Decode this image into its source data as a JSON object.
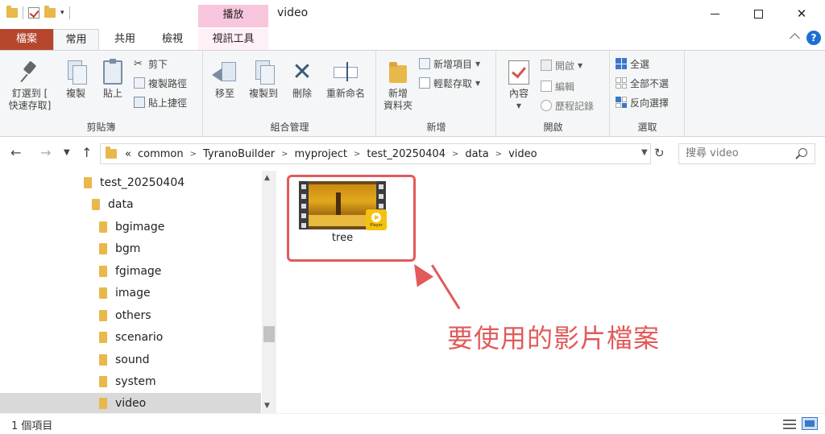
{
  "window": {
    "title": "video",
    "context_tab_header": "播放",
    "buttons": {
      "minimize": "minimize",
      "maximize": "maximize",
      "close": "✕"
    }
  },
  "ribbon_tabs": {
    "file": "檔案",
    "home": "常用",
    "share": "共用",
    "view": "檢視",
    "video_tools": "視訊工具"
  },
  "ribbon": {
    "clipboard": {
      "label": "剪貼簿",
      "pin": "釘選到 [ 快速存取]",
      "pin_line1": "釘選到 [",
      "pin_line2": "快速存取]",
      "copy": "複製",
      "paste": "貼上",
      "cut": "剪下",
      "copy_path": "複製路徑",
      "paste_shortcut": "貼上捷徑"
    },
    "organize": {
      "label": "組合管理",
      "move_to": "移至",
      "copy_to": "複製到",
      "delete": "刪除",
      "rename": "重新命名"
    },
    "new": {
      "label": "新增",
      "new_folder_line1": "新增",
      "new_folder_line2": "資料夾",
      "new_item": "新增項目",
      "easy_access": "輕鬆存取"
    },
    "open": {
      "label": "開啟",
      "properties": "內容",
      "open": "開啟",
      "edit": "編輯",
      "history": "歷程記錄"
    },
    "select": {
      "label": "選取",
      "select_all": "全選",
      "select_none": "全部不選",
      "invert": "反向選擇"
    }
  },
  "address": {
    "prefix": "«",
    "path": [
      "common",
      "TyranoBuilder",
      "myproject",
      "test_20250404",
      "data",
      "video"
    ]
  },
  "search": {
    "placeholder": "搜尋 video"
  },
  "tree": {
    "items": [
      {
        "label": "test_20250404"
      },
      {
        "label": "data"
      },
      {
        "label": "bgimage"
      },
      {
        "label": "bgm"
      },
      {
        "label": "fgimage"
      },
      {
        "label": "image"
      },
      {
        "label": "others"
      },
      {
        "label": "scenario"
      },
      {
        "label": "sound"
      },
      {
        "label": "system"
      },
      {
        "label": "video"
      }
    ]
  },
  "files": [
    {
      "name": "tree",
      "badge": "Player"
    }
  ],
  "annotation": "要使用的影片檔案",
  "status": {
    "item_count": "1 個項目"
  },
  "colors": {
    "file_tab": "#b5462d",
    "context_tab": "#f7c6dd",
    "annotation": "#e25a5a",
    "accent": "#3a78c9"
  },
  "icons": {
    "qa": [
      "folder-icon",
      "properties-icon",
      "new-folder-icon",
      "chevron-down-icon"
    ],
    "nav": [
      "back-arrow-icon",
      "forward-arrow-icon",
      "recent-chevron-icon",
      "up-arrow-icon"
    ]
  }
}
